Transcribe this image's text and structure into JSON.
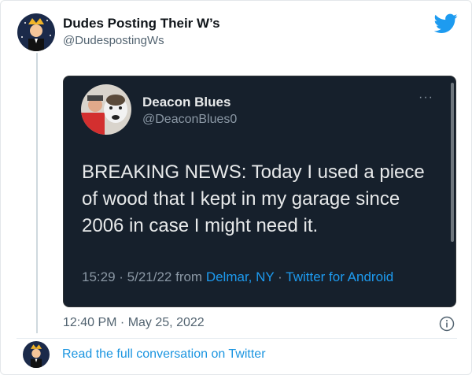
{
  "author": {
    "name": "Dudes Posting Their W’s",
    "handle": "@DudespostingWs"
  },
  "quoted_tweet": {
    "name": "Deacon Blues",
    "handle": "@DeaconBlues0",
    "more": "···",
    "text": "BREAKING NEWS: Today I used a piece of wood that I kept in my garage since 2006 in case I might need it.",
    "time": "15:29 · 5/21/22 from ",
    "location": "Delmar, NY",
    "separator": " · ",
    "source": "Twitter for Android"
  },
  "timestamp": "12:40 PM · May 25, 2022",
  "read_link": "Read the full conversation on Twitter",
  "colors": {
    "twitter_blue": "#1d9bf0",
    "embed_bg": "#16202c"
  },
  "icons": {
    "logo": "twitter-bird-icon",
    "info": "info-icon"
  }
}
